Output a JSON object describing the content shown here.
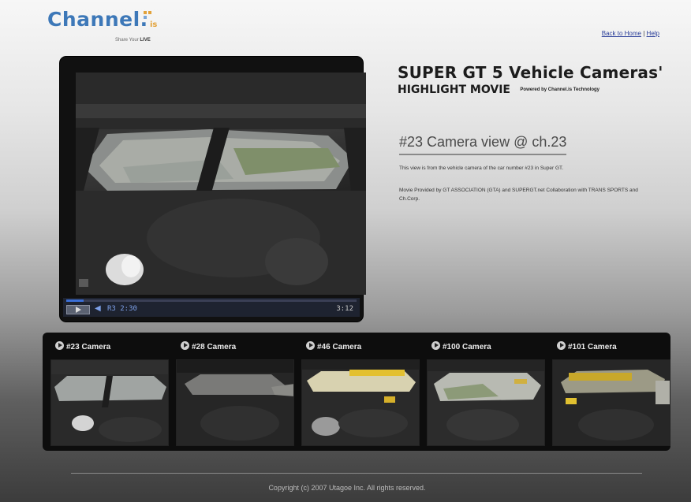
{
  "logo": {
    "word": "Channel.",
    "tagline_prefix": "Share Your",
    "tagline_bold": "LIVE"
  },
  "top_links": {
    "home": "Back to Home",
    "separator": "|",
    "help": "Help"
  },
  "player": {
    "progress": 0.06,
    "time_current": "R3 2:30",
    "time_total": "3:12"
  },
  "headline": {
    "title": "SUPER GT 5 Vehicle Cameras'",
    "subtitle": "HIGHLIGHT MOVIE",
    "powered_by": "Powered by Channel.is Technology"
  },
  "camera_view": {
    "title": "#23 Camera view @ ch.23",
    "description": "This view is from the vehicle camera of the car number #23 in Super GT.",
    "credits": "Movie Provided by GT ASSOCIATION (GTA) and SUPERGT.net Collaboration with TRANS SPORTS and Ch.Corp."
  },
  "thumbnails": [
    {
      "label": "#23 Camera"
    },
    {
      "label": "#28 Camera"
    },
    {
      "label": "#46 Camera"
    },
    {
      "label": "#100 Camera"
    },
    {
      "label": "#101 Camera"
    }
  ],
  "footer": {
    "copyright": "Copyright (c) 2007 Utagoe Inc. All rights reserved."
  },
  "colors": {
    "logo_blue": "#3d78b8",
    "link_blue": "#2b3f9a",
    "progress_blue": "#3b6fd6",
    "strip_bg": "#0d0d0d"
  },
  "icons": {
    "play": "play-icon",
    "volume": "volume-icon",
    "thumb_play": "play-circle-icon"
  }
}
